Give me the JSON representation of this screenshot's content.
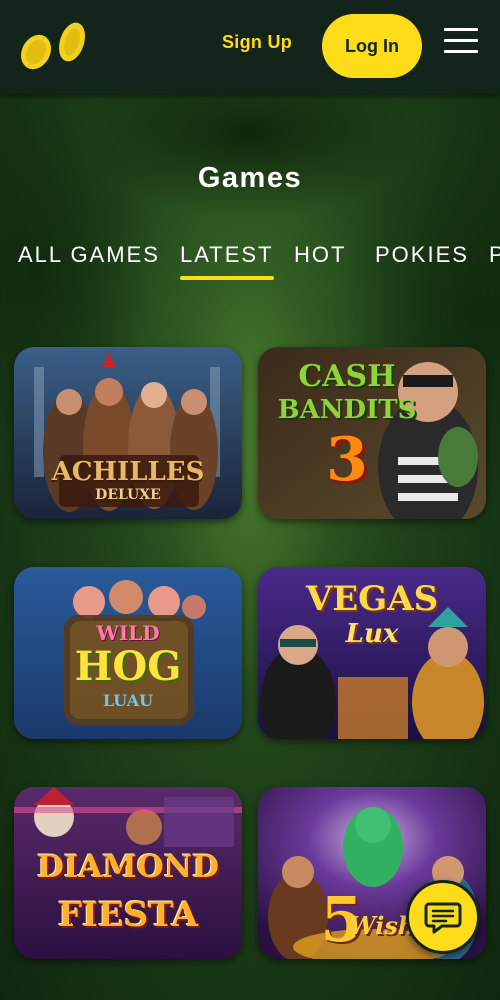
{
  "header": {
    "sign_up_label": "Sign Up",
    "log_in_label": "Log In"
  },
  "section": {
    "title": "Games"
  },
  "tabs": [
    {
      "label": "ALL GAMES",
      "active": false
    },
    {
      "label": "LATEST",
      "active": true
    },
    {
      "label": "HOT",
      "active": false
    },
    {
      "label": "POKIES",
      "active": false
    },
    {
      "label": "P",
      "active": false
    }
  ],
  "games": [
    {
      "title_line1": "ACHILLES",
      "title_line2": "DELUXE"
    },
    {
      "title_line1": "CASH",
      "title_line2": "BANDITS",
      "title_line3": "3"
    },
    {
      "title_line1": "WILD",
      "title_line2": "HOG",
      "title_line3": "LUAU"
    },
    {
      "title_line1": "VEGAS",
      "title_line2": "Lux"
    },
    {
      "title_line1": "DIAMOND",
      "title_line2": "FIESTA"
    },
    {
      "title_line1": "5",
      "title_line2": "Wish"
    }
  ],
  "colors": {
    "accent": "#ffdc1a",
    "header_bg": "#13251b",
    "background": "#1f4219"
  },
  "icons": {
    "logo": "coins-logo-icon",
    "menu": "hamburger-menu-icon",
    "chat": "chat-bubble-icon"
  }
}
